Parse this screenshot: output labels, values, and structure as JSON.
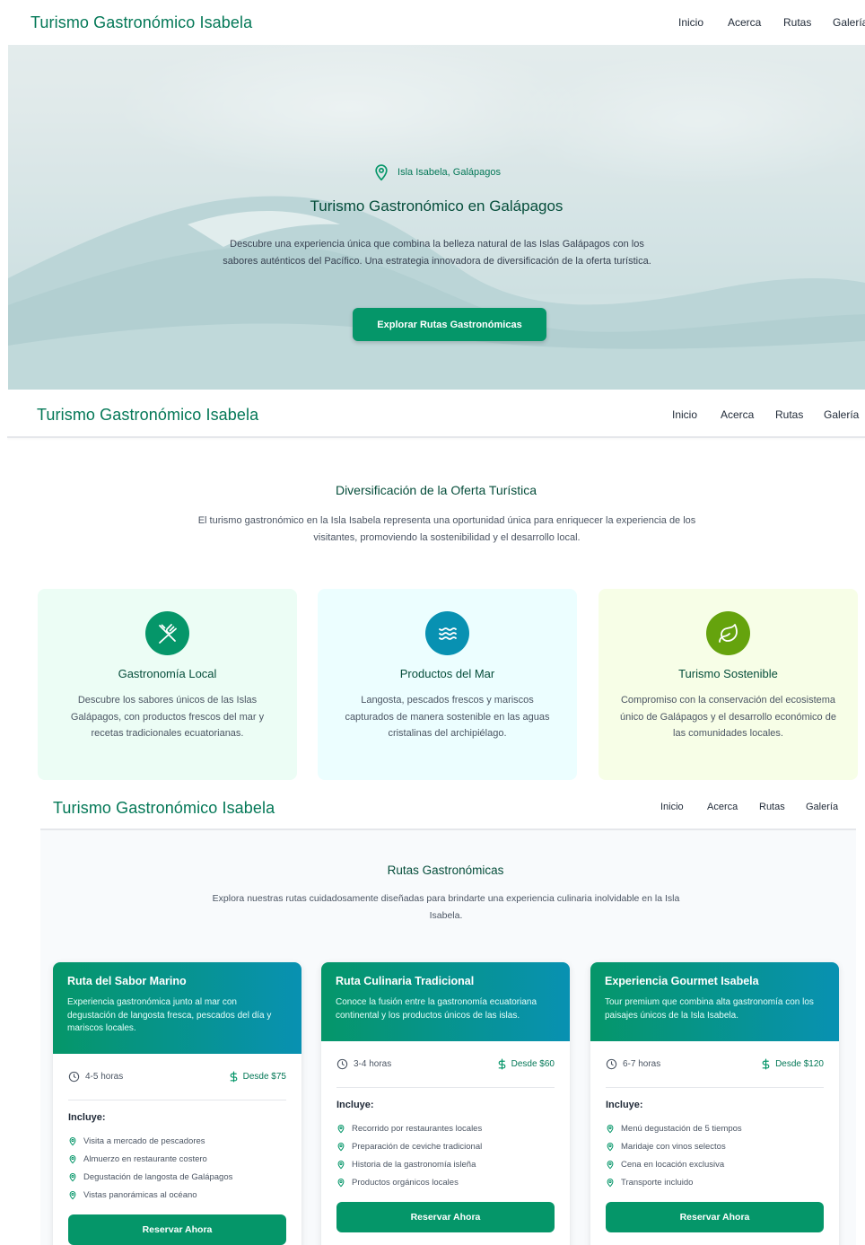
{
  "site": {
    "brand": "Turismo Gastronómico Isabela",
    "nav": [
      "Inicio",
      "Acerca",
      "Rutas",
      "Galería"
    ]
  },
  "hero": {
    "location": "Isla Isabela, Galápagos",
    "title": "Turismo Gastronómico en Galápagos",
    "description": "Descubre una experiencia única que combina la belleza natural de las Islas Galápagos con los sabores auténticos del Pacífico. Una estrategia innovadora de diversificación de la oferta turística.",
    "cta": "Explorar Rutas Gastronómicas"
  },
  "about": {
    "title": "Diversificación de la Oferta Turística",
    "description": "El turismo gastronómico en la Isla Isabela representa una oportunidad única para enriquecer la experiencia de los visitantes, promoviendo la sostenibilidad y el desarrollo local.",
    "features": [
      {
        "title": "Gastronomía Local",
        "text": "Descubre los sabores únicos de las Islas Galápagos, con productos frescos del mar y recetas tradicionales ecuatorianas.",
        "icon": "utensils-crossed-icon",
        "icon_color": "#059669",
        "bg": "#ecfdf5"
      },
      {
        "title": "Productos del Mar",
        "text": "Langosta, pescados frescos y mariscos capturados de manera sostenible en las aguas cristalinas del archipiélago.",
        "icon": "waves-icon",
        "icon_color": "#0891b2",
        "bg": "#ecfeff"
      },
      {
        "title": "Turismo Sostenible",
        "text": "Compromiso con la conservación del ecosistema único de Galápagos y el desarrollo económico de las comunidades locales.",
        "icon": "leaf-icon",
        "icon_color": "#65a30d",
        "bg": "#f7fee7"
      }
    ]
  },
  "routes": {
    "title": "Rutas Gastronómicas",
    "description": "Explora nuestras rutas cuidadosamente diseñadas para brindarte una experiencia culinaria inolvidable en la Isla Isabela.",
    "includes_label": "Incluye:",
    "book_label": "Reservar Ahora",
    "items": [
      {
        "title": "Ruta del Sabor Marino",
        "description": "Experiencia gastronómica junto al mar con degustación de langosta fresca, pescados del día y mariscos locales.",
        "duration": "4-5 horas",
        "price": "Desde $75",
        "includes": [
          "Visita a mercado de pescadores",
          "Almuerzo en restaurante costero",
          "Degustación de langosta de Galápagos",
          "Vistas panorámicas al océano"
        ]
      },
      {
        "title": "Ruta Culinaria Tradicional",
        "description": "Conoce la fusión entre la gastronomía ecuatoriana continental y los productos únicos de las islas.",
        "duration": "3-4 horas",
        "price": "Desde $60",
        "includes": [
          "Recorrido por restaurantes locales",
          "Preparación de ceviche tradicional",
          "Historia de la gastronomía isleña",
          "Productos orgánicos locales"
        ]
      },
      {
        "title": "Experiencia Gourmet Isabela",
        "description": "Tour premium que combina alta gastronomía con los paisajes únicos de la Isla Isabela.",
        "duration": "6-7 horas",
        "price": "Desde $120",
        "includes": [
          "Menú degustación de 5 tiempos",
          "Maridaje con vinos selectos",
          "Cena en locación exclusiva",
          "Transporte incluido"
        ]
      }
    ]
  }
}
